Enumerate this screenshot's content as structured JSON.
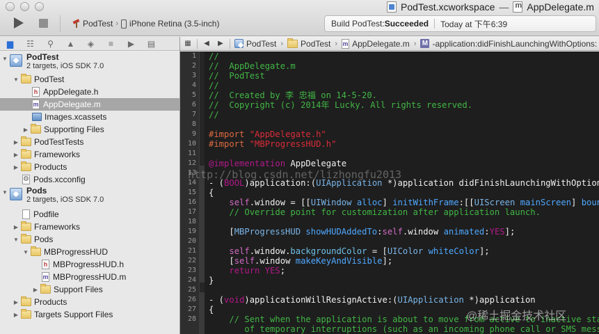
{
  "window": {
    "workspace_title": "PodTest.xcworkspace",
    "title_separator": "—",
    "file_title": "AppDelegate.m"
  },
  "toolbar": {
    "scheme_target": "PodTest",
    "scheme_device": "iPhone Retina (3.5-inch)",
    "activity_prefix": "Build PodTest: ",
    "activity_status": "Succeeded",
    "activity_time": "Today at 下午6:39"
  },
  "navigator": {
    "tab_icons": [
      "folder-icon",
      "symbol-icon",
      "search-icon",
      "issue-icon",
      "test-icon",
      "debug-icon",
      "breakpoint-icon",
      "log-icon"
    ],
    "rows": [
      {
        "kind": "project",
        "name": "PodTest",
        "sub": "2 targets, iOS SDK 7.0"
      },
      {
        "kind": "folder",
        "label": "PodTest"
      },
      {
        "kind": "file-h",
        "label": "AppDelegate.h"
      },
      {
        "kind": "file-m",
        "label": "AppDelegate.m",
        "selected": true
      },
      {
        "kind": "assets",
        "label": "Images.xcassets"
      },
      {
        "kind": "folder",
        "label": "Supporting Files"
      },
      {
        "kind": "folder",
        "label": "PodTestTests"
      },
      {
        "kind": "folder",
        "label": "Frameworks"
      },
      {
        "kind": "folder",
        "label": "Products"
      },
      {
        "kind": "config",
        "label": "Pods.xcconfig"
      },
      {
        "kind": "project",
        "name": "Pods",
        "sub": "2 targets, iOS SDK 7.0"
      },
      {
        "kind": "file",
        "label": "Podfile"
      },
      {
        "kind": "folder",
        "label": "Frameworks"
      },
      {
        "kind": "folder",
        "label": "Pods"
      },
      {
        "kind": "folder",
        "label": "MBProgressHUD"
      },
      {
        "kind": "file-h",
        "label": "MBProgressHUD.h"
      },
      {
        "kind": "file-m",
        "label": "MBProgressHUD.m"
      },
      {
        "kind": "folder",
        "label": "Support Files"
      },
      {
        "kind": "folder",
        "label": "Products"
      },
      {
        "kind": "folder",
        "label": "Targets Support Files"
      }
    ]
  },
  "jumpbar": {
    "crumbs": [
      "PodTest",
      "PodTest",
      "AppDelegate.m",
      "M",
      "-application:didFinishLaunchingWithOptions:"
    ]
  },
  "editor": {
    "line_numbers": [
      "1",
      "2",
      "3",
      "4",
      "5",
      "6",
      "7",
      "8",
      "9",
      "10",
      "11",
      "12",
      "13",
      "14",
      "15",
      "16",
      "17",
      "18",
      "19",
      "20",
      "21",
      "22",
      "23",
      "24",
      "25",
      "26",
      "27",
      "28"
    ],
    "watermark_url": "http://blog.csdn.net/lizhongfu2013",
    "watermark_brand": "@稀土掘金技术社区"
  }
}
